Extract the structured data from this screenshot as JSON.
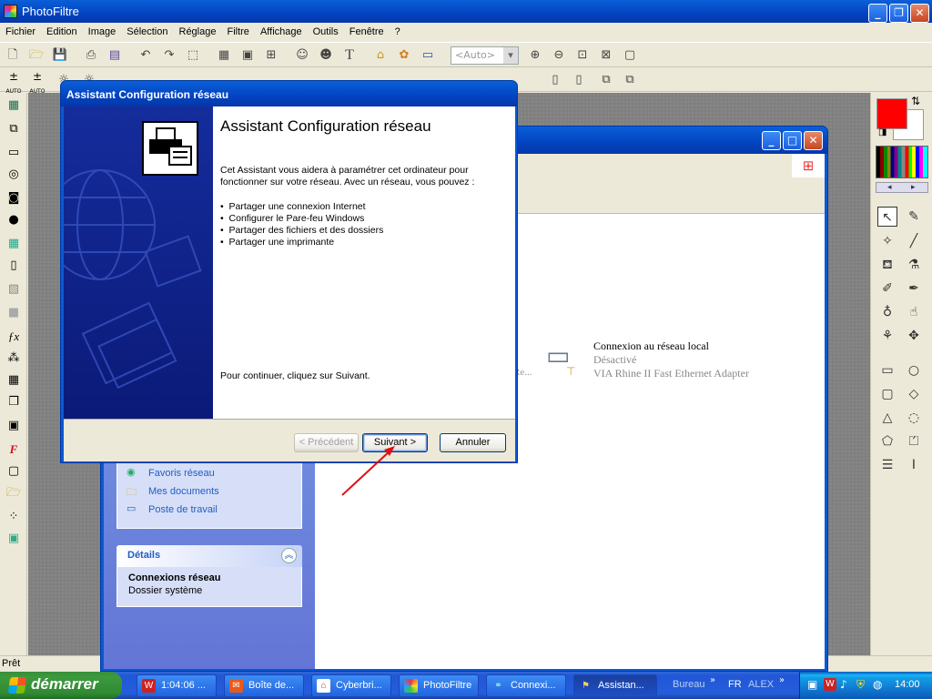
{
  "photofiltre": {
    "title": "PhotoFiltre",
    "menu": [
      "Fichier",
      "Edition",
      "Image",
      "Sélection",
      "Réglage",
      "Filtre",
      "Affichage",
      "Outils",
      "Fenêtre",
      "?"
    ],
    "zoom_value": "<Auto>",
    "tool_auto": "AUTO",
    "status": "Prêt"
  },
  "network_window": {
    "left_panel": {
      "links": [
        "Favoris réseau",
        "Mes documents",
        "Poste de travail"
      ],
      "details_title": "Détails",
      "details_name": "Connexions réseau",
      "details_type": "Dossier système"
    },
    "connection": {
      "name": "Connexion au réseau local",
      "status": "Désactivé",
      "adapter": "VIA Rhine II Fast Ethernet Adapter",
      "truncated": "Re..."
    }
  },
  "wizard": {
    "title": "Assistant Configuration réseau",
    "heading": "Assistant Configuration réseau",
    "intro": "Cet Assistant vous aidera à paramétrer cet ordinateur pour fonctionner sur votre réseau. Avec un réseau, vous pouvez :",
    "bullets": [
      "Partager une connexion Internet",
      "Configurer le Pare-feu Windows",
      "Partager des fichiers et des dossiers",
      "Partager une imprimante"
    ],
    "continue": "Pour continuer, cliquez sur Suivant.",
    "btn_prev": "< Précédent",
    "btn_next": "Suivant >",
    "btn_cancel": "Annuler"
  },
  "taskbar": {
    "start": "démarrer",
    "items": [
      {
        "label": "1:04:06 ..."
      },
      {
        "label": "Boîte de..."
      },
      {
        "label": "Cyberbri..."
      },
      {
        "label": "PhotoFiltre"
      },
      {
        "label": "Connexi..."
      },
      {
        "label": "Assistan..."
      }
    ],
    "bureau": "Bureau",
    "lang": "FR",
    "user": "ALEX",
    "clock": "14:00"
  },
  "colors": {
    "foreground": "#ff0000",
    "background": "#ffffff",
    "xp_blue": "#0343c0",
    "wizard_banner": "#0f1f8a"
  },
  "icons": [
    "new-file-icon",
    "open-folder-icon",
    "save-icon",
    "print-icon",
    "undo-icon",
    "redo-icon",
    "zoom-in-icon",
    "zoom-out-icon",
    "arrow-cursor-icon",
    "eyedropper-icon",
    "magic-wand-icon",
    "line-icon",
    "paint-bucket-icon",
    "spray-icon",
    "brush-icon",
    "pen-icon",
    "blur-drop-icon",
    "finger-icon",
    "stamp-icon",
    "move-icon",
    "rectangle-icon",
    "ellipse-icon",
    "rounded-rect-icon",
    "diamond-icon",
    "triangle-icon",
    "lasso-icon",
    "polygon-icon",
    "xp-flag-icon",
    "computer-icon",
    "printer-icon"
  ]
}
